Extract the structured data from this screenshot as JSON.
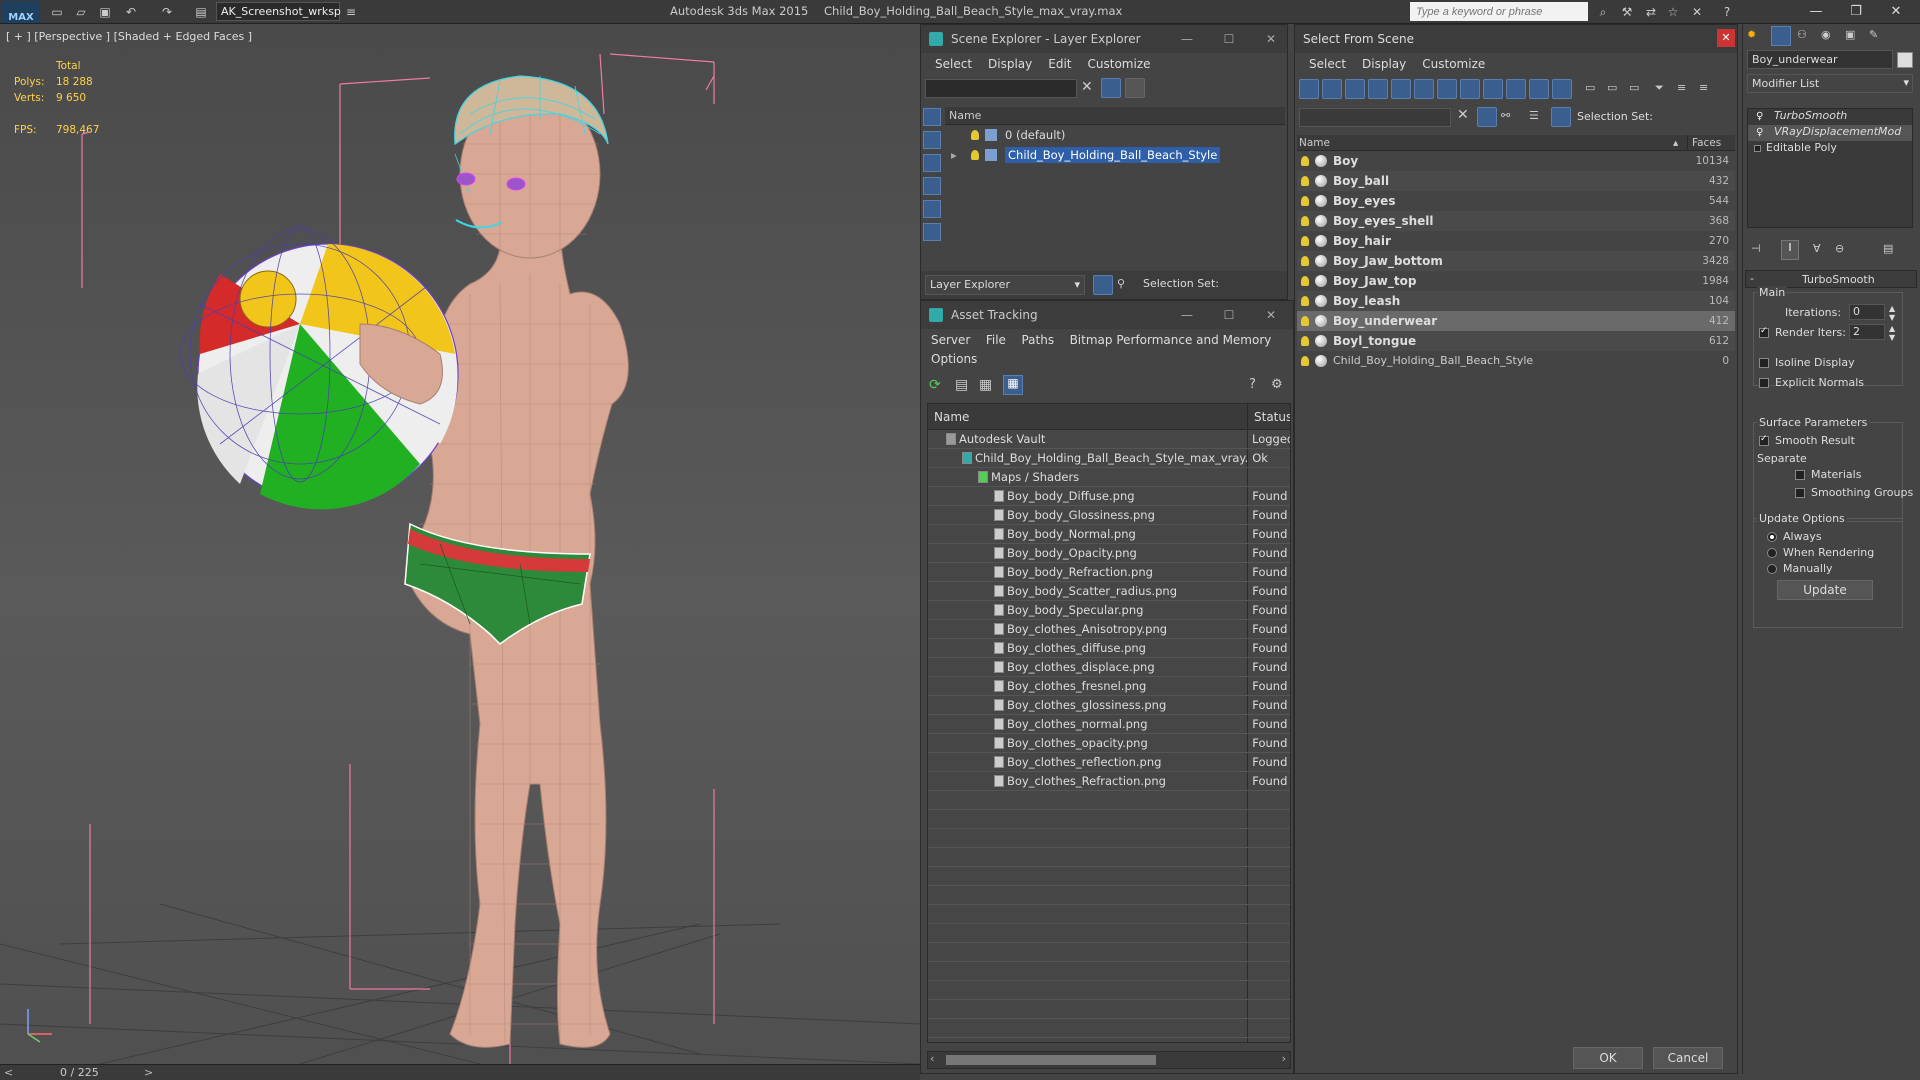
{
  "topbar": {
    "logo": "MAX",
    "workspace": "AK_Screenshot_wrksp",
    "title_app": "Autodesk 3ds Max  2015",
    "title_file": "Child_Boy_Holding_Ball_Beach_Style_max_vray.max",
    "search_placeholder": "Type a keyword or phrase"
  },
  "viewport": {
    "label": "[ + ] [Perspective ] [Shaded + Edged Faces ]",
    "stats": {
      "total_label": "Total",
      "polys_label": "Polys:",
      "polys_value": "18 288",
      "verts_label": "Verts:",
      "verts_value": "9 650",
      "fps_label": "FPS:",
      "fps_value": "798,467"
    }
  },
  "statusbar": {
    "frame": "0 / 225"
  },
  "scene_explorer": {
    "title": "Scene Explorer - Layer Explorer",
    "menu": [
      "Select",
      "Display",
      "Edit",
      "Customize"
    ],
    "col_name": "Name",
    "rows": [
      {
        "label": "0 (default)"
      },
      {
        "label": "Child_Boy_Holding_Ball_Beach_Style"
      }
    ],
    "footer_dropdown": "Layer Explorer",
    "selection_set_label": "Selection Set:"
  },
  "asset_tracking": {
    "title": "Asset Tracking",
    "menu": [
      "Server",
      "File",
      "Paths",
      "Bitmap Performance and Memory",
      "Options"
    ],
    "col_name": "Name",
    "col_status": "Status",
    "rows": [
      {
        "name": "Autodesk Vault",
        "status": "Logged"
      },
      {
        "name": "Child_Boy_Holding_Ball_Beach_Style_max_vray....",
        "status": "Ok"
      },
      {
        "name": "Maps / Shaders",
        "status": ""
      },
      {
        "name": "Boy_body_Diffuse.png",
        "status": "Found"
      },
      {
        "name": "Boy_body_Glossiness.png",
        "status": "Found"
      },
      {
        "name": "Boy_body_Normal.png",
        "status": "Found"
      },
      {
        "name": "Boy_body_Opacity.png",
        "status": "Found"
      },
      {
        "name": "Boy_body_Refraction.png",
        "status": "Found"
      },
      {
        "name": "Boy_body_Scatter_radius.png",
        "status": "Found"
      },
      {
        "name": "Boy_body_Specular.png",
        "status": "Found"
      },
      {
        "name": "Boy_clothes_Anisotropy.png",
        "status": "Found"
      },
      {
        "name": "Boy_clothes_diffuse.png",
        "status": "Found"
      },
      {
        "name": "Boy_clothes_displace.png",
        "status": "Found"
      },
      {
        "name": "Boy_clothes_fresnel.png",
        "status": "Found"
      },
      {
        "name": "Boy_clothes_glossiness.png",
        "status": "Found"
      },
      {
        "name": "Boy_clothes_normal.png",
        "status": "Found"
      },
      {
        "name": "Boy_clothes_opacity.png",
        "status": "Found"
      },
      {
        "name": "Boy_clothes_reflection.png",
        "status": "Found"
      },
      {
        "name": "Boy_clothes_Refraction.png",
        "status": "Found"
      }
    ]
  },
  "select_from_scene": {
    "title": "Select From Scene",
    "menu": [
      "Select",
      "Display",
      "Customize"
    ],
    "selection_set_label": "Selection Set:",
    "col_name": "Name",
    "col_faces": "Faces",
    "rows": [
      {
        "name": "Boy",
        "faces": "10134"
      },
      {
        "name": "Boy_ball",
        "faces": "432"
      },
      {
        "name": "Boy_eyes",
        "faces": "544"
      },
      {
        "name": "Boy_eyes_shell",
        "faces": "368"
      },
      {
        "name": "Boy_hair",
        "faces": "270"
      },
      {
        "name": "Boy_Jaw_bottom",
        "faces": "3428"
      },
      {
        "name": "Boy_Jaw_top",
        "faces": "1984"
      },
      {
        "name": "Boy_leash",
        "faces": "104"
      },
      {
        "name": "Boy_underwear",
        "faces": "412"
      },
      {
        "name": "Boyl_tongue",
        "faces": "612"
      },
      {
        "name": "Child_Boy_Holding_Ball_Beach_Style",
        "faces": "0"
      }
    ],
    "ok_label": "OK",
    "cancel_label": "Cancel"
  },
  "command_panel": {
    "object_name": "Boy_underwear",
    "modifier_list": "Modifier List",
    "stack": [
      "TurboSmooth",
      "VRayDisplacementMod",
      "Editable Poly"
    ],
    "rollout_title": "TurboSmooth",
    "main_label": "Main",
    "iterations_label": "Iterations:",
    "iterations_value": "0",
    "render_iters_label": "Render Iters:",
    "render_iters_value": "2",
    "isoline_label": "Isoline Display",
    "explicit_normals_label": "Explicit Normals",
    "surface_params_label": "Surface Parameters",
    "smooth_result_label": "Smooth Result",
    "separate_label": "Separate",
    "materials_label": "Materials",
    "smoothing_groups_label": "Smoothing Groups",
    "update_options_label": "Update Options",
    "always_label": "Always",
    "when_rendering_label": "When Rendering",
    "manually_label": "Manually",
    "update_button": "Update"
  },
  "colors": {
    "selection_blue": "#2f5fa8",
    "stats_yellow": "#ffd24a",
    "close_red": "#cc3333"
  }
}
